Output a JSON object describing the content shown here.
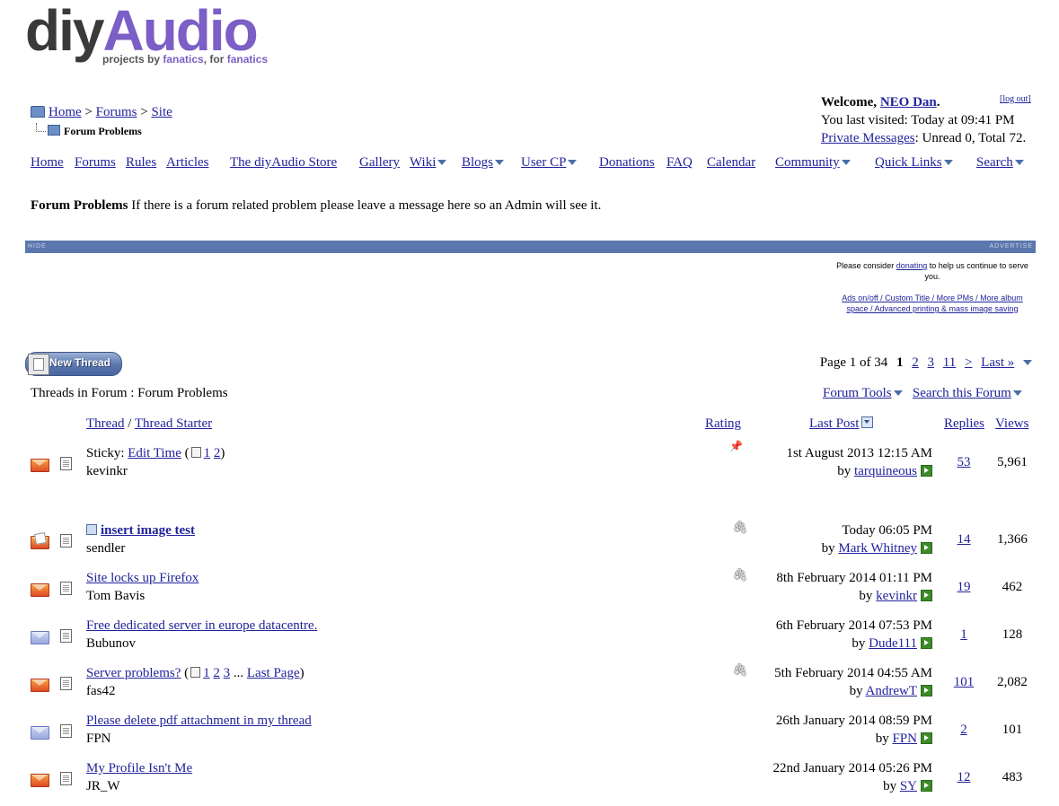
{
  "logo": {
    "diy": "diy",
    "audio": "Audio",
    "tag_pre": "projects by ",
    "tag_fan1": "fanatics",
    "tag_mid": ", for ",
    "tag_fan2": "fanatics"
  },
  "breadcrumb": {
    "home": "Home",
    "sep": ">",
    "forums": "Forums",
    "site": "Site",
    "current": "Forum Problems"
  },
  "welcome": {
    "prefix": "Welcome, ",
    "user": "NEO Dan",
    "suffix": ".",
    "logout": "[log out]",
    "last_visited": "You last visited: Today at 09:41 PM",
    "pm_link": "Private Messages",
    "pm_text": ": Unread 0, Total 72."
  },
  "nav": [
    "Home",
    "Forums",
    "Rules",
    "Articles",
    "The diyAudio Store",
    "Gallery",
    "Wiki",
    "Blogs",
    "User CP",
    "Donations",
    "FAQ",
    "Calendar",
    "Community",
    "Quick Links",
    "Search"
  ],
  "forum": {
    "name": "Forum Problems",
    "description": " If there is a forum related problem please leave a message here so an Admin will see it."
  },
  "ad": {
    "hide": "HIDE",
    "advertise": "ADVERTISE",
    "donate_pre": "Please consider ",
    "donate_link": "donating",
    "donate_post": " to help us continue to serve you.",
    "links": "Ads on/off / Custom Title / More PMs / More album space / Advanced printing & mass image saving"
  },
  "new_thread": "New Thread",
  "pager": {
    "label": "Page 1 of 34",
    "current": "1",
    "pages": [
      "2",
      "3",
      "11"
    ],
    "next": ">",
    "last": "Last »"
  },
  "threads_in": "Threads in Forum : Forum Problems",
  "tools": {
    "forum_tools": "Forum Tools",
    "search_forum": "Search this Forum"
  },
  "columns": {
    "thread": "Thread",
    "slash": " / ",
    "starter": "Thread Starter",
    "rating": "Rating",
    "last_post": "Last Post",
    "replies": "Replies",
    "views": "Views"
  },
  "threads": [
    {
      "prefix": "Sticky: ",
      "title": "Edit Time",
      "pages": "1 2",
      "starter": "kevinkr",
      "date": "1st August 2013 12:15 AM",
      "by": "tarquineous",
      "replies": "53",
      "views": "5,961"
    },
    {
      "title": "insert image test",
      "starter": "sendler",
      "date": "Today 06:05 PM",
      "by": "Mark Whitney",
      "replies": "14",
      "views": "1,366"
    },
    {
      "title": "Site locks up Firefox",
      "starter": "Tom Bavis",
      "date": "8th February 2014 01:11 PM",
      "by": "kevinkr",
      "replies": "19",
      "views": "462"
    },
    {
      "title": "Free dedicated server in europe datacentre.",
      "starter": "Bubunov",
      "date": "6th February 2014 07:53 PM",
      "by": "Dude111",
      "replies": "1",
      "views": "128"
    },
    {
      "title": "Server problems?",
      "pages": "1 2 3",
      "last_page": "Last Page",
      "starter": "fas42",
      "date": "5th February 2014 04:55 AM",
      "by": "AndrewT",
      "replies": "101",
      "views": "2,082"
    },
    {
      "title": "Please delete pdf attachment in my thread",
      "starter": "FPN",
      "date": "26th January 2014 08:59 PM",
      "by": "FPN",
      "replies": "2",
      "views": "101"
    },
    {
      "title": "My Profile Isn't Me",
      "starter": "JR_W",
      "date": "22nd January 2014 05:26 PM",
      "by": "SY",
      "replies": "12",
      "views": "483"
    }
  ],
  "by_label": "by ",
  "icons": {
    "sticky": "pushpin-icon",
    "attachment": "paperclip-icon",
    "go": "go-to-last-post-icon"
  }
}
